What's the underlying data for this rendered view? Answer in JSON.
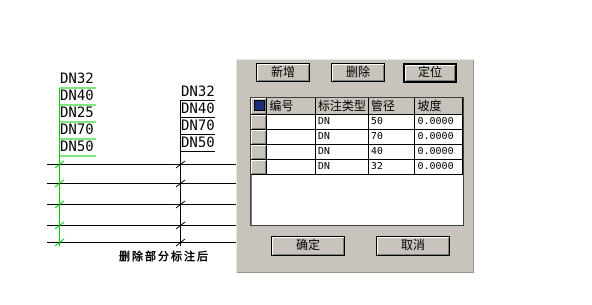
{
  "drawing": {
    "left_labels": [
      "DN32",
      "DN40",
      "DN25",
      "DN70",
      "DN50"
    ],
    "middle_labels": [
      "DN32",
      "DN40",
      "DN70",
      "DN50"
    ],
    "caption": "删除部分标注后",
    "line_color": "#00cc00"
  },
  "dialog": {
    "buttons": {
      "add": "新增",
      "delete": "删除",
      "locate": "定位",
      "ok": "确定",
      "cancel": "取消"
    },
    "table": {
      "columns": [
        "编号",
        "标注类型",
        "管径",
        "坡度"
      ],
      "rows": [
        {
          "id": "",
          "type": "DN",
          "diameter": "50",
          "slope": "0.0000"
        },
        {
          "id": "",
          "type": "DN",
          "diameter": "70",
          "slope": "0.0000"
        },
        {
          "id": "",
          "type": "DN",
          "diameter": "40",
          "slope": "0.0000"
        },
        {
          "id": "",
          "type": "DN",
          "diameter": "32",
          "slope": "0.0000"
        }
      ]
    }
  }
}
